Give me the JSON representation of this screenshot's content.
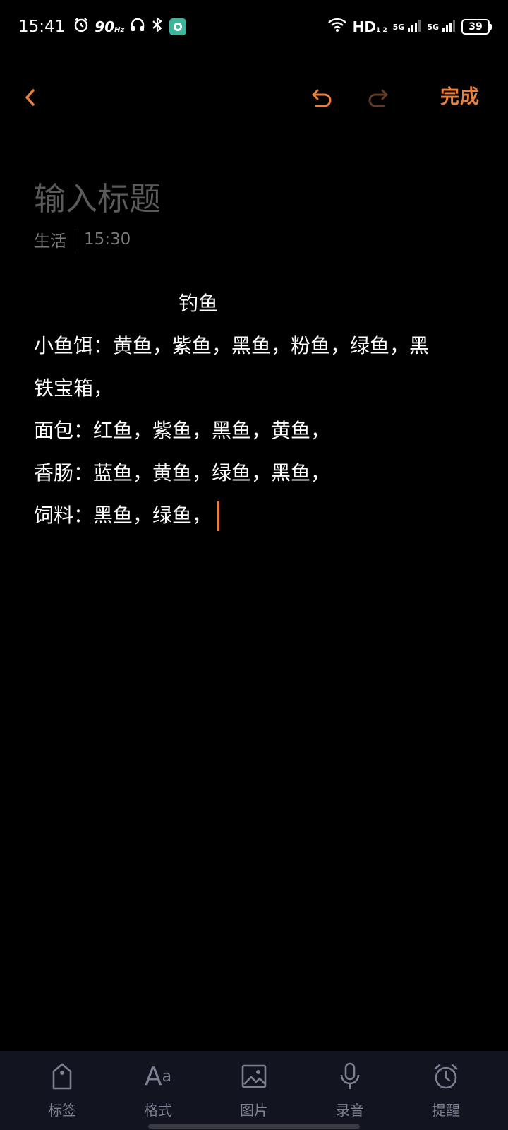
{
  "status_bar": {
    "time": "15:41",
    "refresh_rate": "90",
    "refresh_unit": "Hz",
    "network_label": "HD",
    "network_sub": "1 2",
    "sim1": "5G",
    "sim2": "5G",
    "battery": "39"
  },
  "toolbar": {
    "done_label": "完成",
    "accent_color": "#e9803b"
  },
  "note": {
    "title_placeholder": "输入标题",
    "category": "生活",
    "time": "15:30",
    "heading": "钓鱼",
    "lines": [
      "小鱼饵：黄鱼，紫鱼，黑鱼，粉鱼，绿鱼，黑",
      "铁宝箱，",
      "面包：红鱼，紫鱼，黑鱼，黄鱼，",
      "香肠：蓝鱼，黄鱼，绿鱼，黑鱼，",
      "饲料：黑鱼，绿鱼，"
    ]
  },
  "bottom_bar": {
    "items": [
      {
        "label": "标签",
        "icon": "tag-icon"
      },
      {
        "label": "格式",
        "icon": "format-icon"
      },
      {
        "label": "图片",
        "icon": "image-icon"
      },
      {
        "label": "录音",
        "icon": "microphone-icon"
      },
      {
        "label": "提醒",
        "icon": "alarm-icon"
      }
    ]
  }
}
